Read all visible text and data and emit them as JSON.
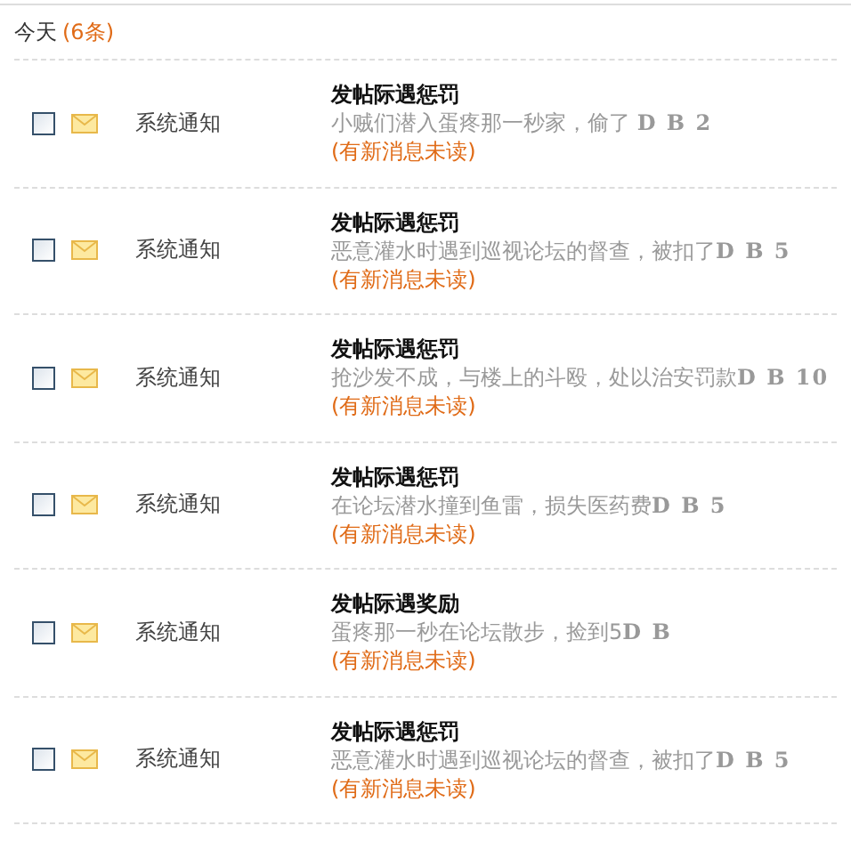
{
  "group": {
    "label": "今天",
    "count": "(6条)"
  },
  "messages": [
    {
      "checked": false,
      "sender": "系统通知",
      "title": "发帖际遇惩罚",
      "body": "小贼们潜入蛋疼那一秒家，偷了 **D B 2**",
      "status": "(有新消息未读)"
    },
    {
      "checked": false,
      "sender": "系统通知",
      "title": "发帖际遇惩罚",
      "body": "恶意灌水时遇到巡视论坛的督查，被扣了**D B 5**",
      "status": "(有新消息未读)"
    },
    {
      "checked": false,
      "sender": "系统通知",
      "title": "发帖际遇惩罚",
      "body": "抢沙发不成，与楼上的斗殴，处以治安罚款**D B 10**",
      "status": "(有新消息未读)"
    },
    {
      "checked": false,
      "sender": "系统通知",
      "title": "发帖际遇惩罚",
      "body": "在论坛潜水撞到鱼雷，损失医药费**D B 5**",
      "status": "(有新消息未读)"
    },
    {
      "checked": false,
      "sender": "系统通知",
      "title": "发帖际遇奖励",
      "body": "蛋疼那一秒在论坛散步，捡到5**D B**",
      "status": "(有新消息未读)"
    },
    {
      "checked": false,
      "sender": "系统通知",
      "title": "发帖际遇惩罚",
      "body": "恶意灌水时遇到巡视论坛的督查，被扣了**D B 5**",
      "status": "(有新消息未读)"
    }
  ]
}
